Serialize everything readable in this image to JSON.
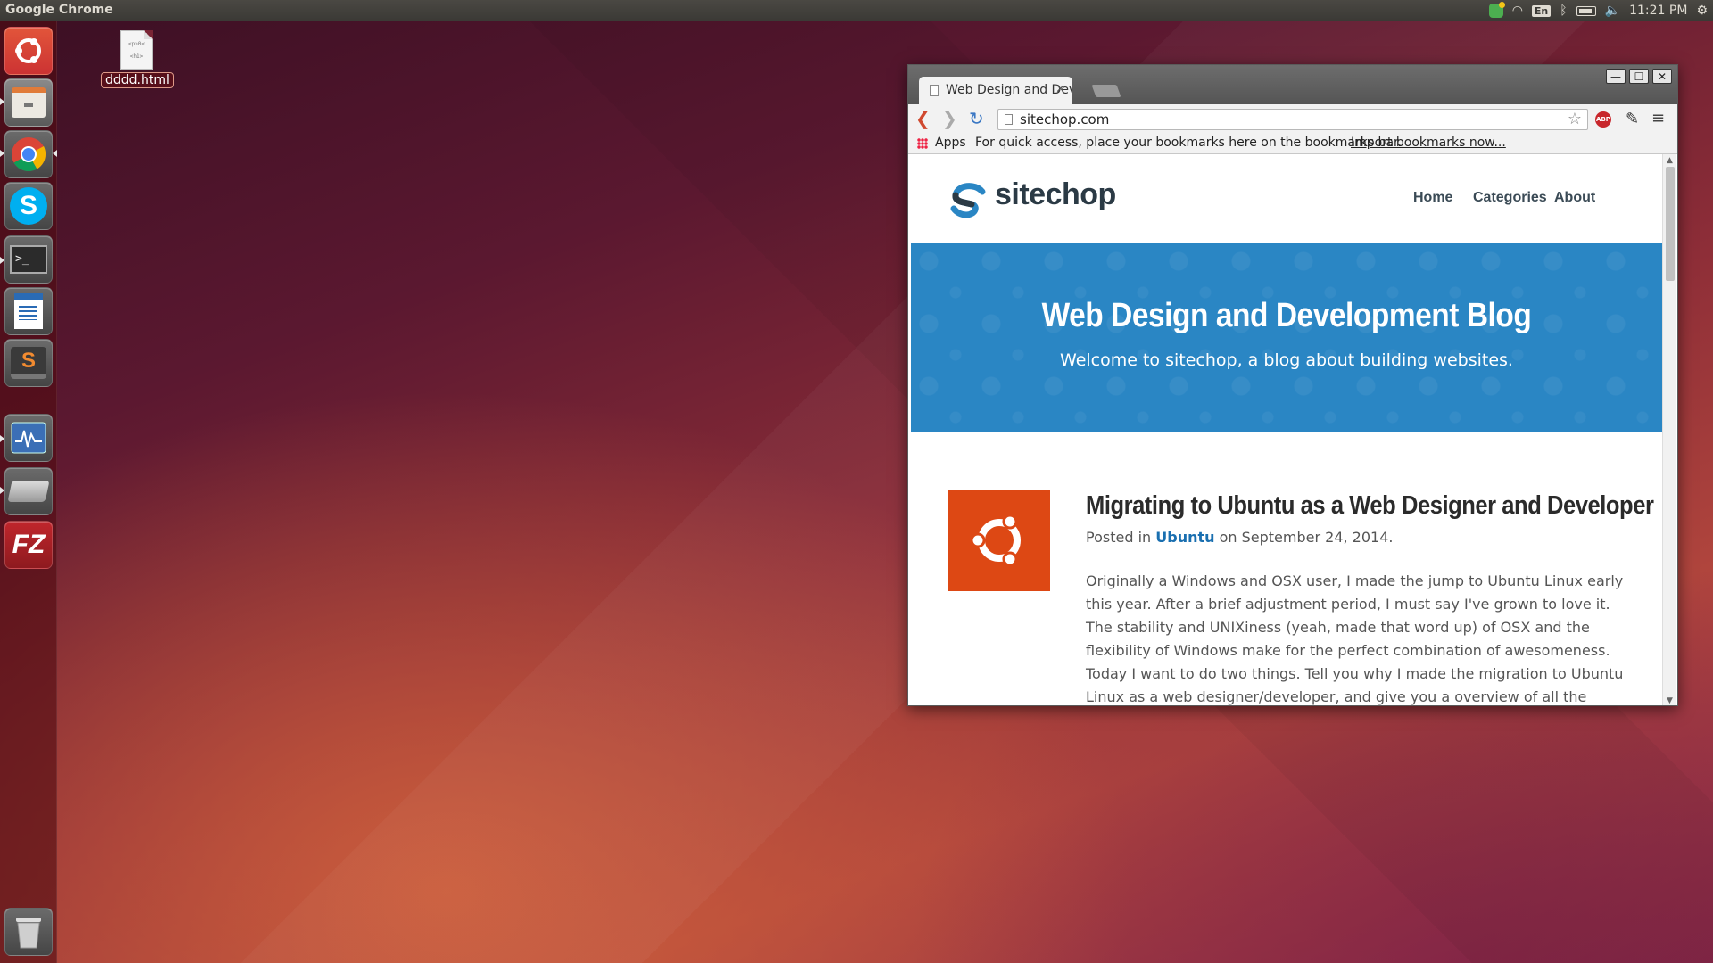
{
  "top_panel": {
    "app_title": "Google Chrome",
    "lang": "En",
    "clock": "11:21 PM"
  },
  "desktop": {
    "file_name": "dddd.html",
    "file_preview": "<p>0<",
    "file_preview2": "<h1>"
  },
  "launcher": {
    "items": [
      "dash-home",
      "files",
      "google-chrome",
      "skype",
      "terminal",
      "libreoffice-writer",
      "sublime-text",
      "system-monitor",
      "scanner",
      "filezilla",
      "trash"
    ]
  },
  "browser": {
    "tab_title": "Web Design and Deve",
    "url": "sitechop.com",
    "bookmarks": {
      "apps": "Apps",
      "message": "For quick access, place your bookmarks here on the bookmarks bar.",
      "import_link": "Import bookmarks now..."
    },
    "abp_label": "ABP"
  },
  "site": {
    "logo": "sitechop",
    "nav": [
      "Home",
      "Categories",
      "About"
    ],
    "hero_title": "Web Design and Development Blog",
    "hero_subtitle": "Welcome to sitechop, a blog about building websites.",
    "post": {
      "title": "Migrating to Ubuntu as a Web Designer and Developer",
      "meta_prefix": "Posted in",
      "category": "Ubuntu",
      "meta_suffix": "on September 24, 2014.",
      "body": "Originally a Windows and OSX user, I made the jump to Ubuntu Linux early this year. After a brief adjustment period, I must say I've grown to love it. The stability and UNIXiness (yeah, made that word up) of OSX and the flexibility of Windows make for the perfect combination of awesomeness. Today I want to do two things. Tell you why I made the migration to Ubuntu Linux as a web designer/developer, and give you a overview of all the different softwares I use"
    }
  },
  "colors": {
    "hero_blue": "#2a86c4",
    "ubuntu_orange": "#dd4814",
    "link_blue": "#1a6fb0"
  }
}
